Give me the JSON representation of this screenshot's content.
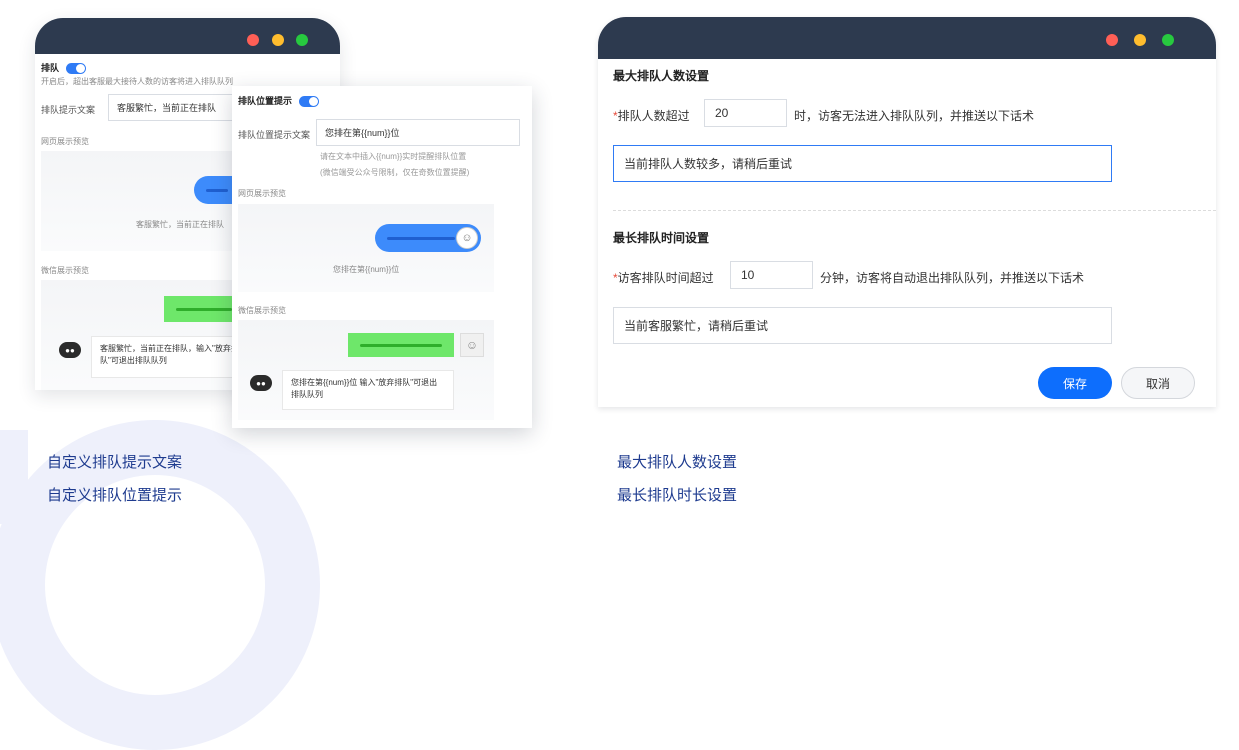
{
  "left_window": {
    "queue_label": "排队",
    "queue_desc": "开启后，超出客服最大接待人数的访客将进入排队队列",
    "prompt_text_label": "排队提示文案",
    "prompt_text_value": "客服繁忙，当前正在排队",
    "web_preview_label": "网页展示预览",
    "web_preview_text": "客服繁忙，当前正在排队",
    "wechat_preview_label": "微信展示预览",
    "wechat_card_text": "客服繁忙，当前正在排队，输入\"放弃排队\"可退出排队队列"
  },
  "overlay_window": {
    "position_label": "排队位置提示",
    "position_text_label": "排队位置提示文案",
    "position_text_value": "您排在第{{num}}位",
    "hint_line1": "请在文本中插入{{num}}实时提醒排队位置",
    "hint_line2": "(微信端受公众号限制，仅在奇数位置提醒)",
    "web_preview_label": "网页展示预览",
    "web_preview_text": "您排在第{{num}}位",
    "wechat_preview_label": "微信展示预览",
    "wechat_card_text": "您排在第{{num}}位 输入\"放弃排队\"可退出排队队列"
  },
  "right_window": {
    "max_section_title": "最大排队人数设置",
    "max_label": "排队人数超过",
    "max_value": "20",
    "max_suffix": "时，访客无法进入排队队列，并推送以下话术",
    "max_message": "当前排队人数较多，请稍后重试",
    "time_section_title": "最长排队时间设置",
    "time_label": "访客排队时间超过",
    "time_value": "10",
    "time_suffix": "分钟，访客将自动退出排队队列，并推送以下话术",
    "time_message": "当前客服繁忙，请稍后重试",
    "save_label": "保存",
    "cancel_label": "取消",
    "required_mark": "*"
  },
  "captions": {
    "left_1": "自定义排队提示文案",
    "left_2": "自定义排队位置提示",
    "right_1": "最大排队人数设置",
    "right_2": "最长排队时长设置"
  },
  "icons": {
    "window_dots": [
      "red-dot",
      "yellow-dot",
      "green-dot"
    ],
    "user_avatar": "user-avatar-icon",
    "bot_avatar": "robot-icon"
  },
  "colors": {
    "titlebar": "#2d3a4f",
    "accent": "#2f7bf5",
    "primary_button": "#0d6efd",
    "caption": "#1e3b8f",
    "wechat_green": "#6ee76a"
  }
}
